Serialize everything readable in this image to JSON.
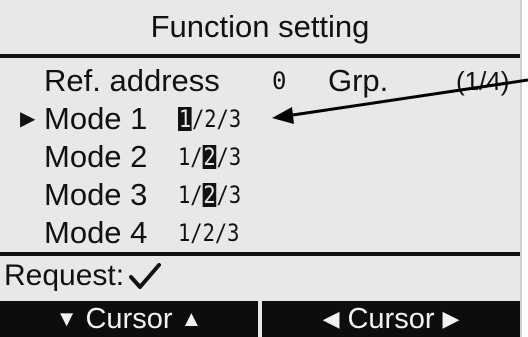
{
  "title": "Function setting",
  "header_row": {
    "label": "Ref. address",
    "address_value": "0",
    "group_label": "Grp.",
    "page": "(1/4)"
  },
  "cursor_symbol": "▶",
  "modes": [
    {
      "label": "Mode 1",
      "options": [
        "1",
        "/",
        "2",
        "/",
        "3"
      ],
      "selected_index": 0
    },
    {
      "label": "Mode 2",
      "options": [
        "1",
        "/",
        "2",
        "/",
        "3"
      ],
      "selected_index": 2
    },
    {
      "label": "Mode 3",
      "options": [
        "1",
        "/",
        "2",
        "/",
        "3"
      ],
      "selected_index": 2
    },
    {
      "label": "Mode 4",
      "options": [
        "1",
        "/",
        "2",
        "/",
        "3"
      ],
      "selected_index": -1
    }
  ],
  "request_label": "Request:",
  "softkeys": {
    "left": {
      "label": "Cursor",
      "icon_left": "▼",
      "icon_right": "▲"
    },
    "right": {
      "label": "Cursor",
      "icon_left": "◀",
      "icon_right": "▶"
    }
  },
  "colors": {
    "screen_bg": "#e8e8e8",
    "ink": "#111111",
    "softkey_bg": "#0d0d0d"
  }
}
